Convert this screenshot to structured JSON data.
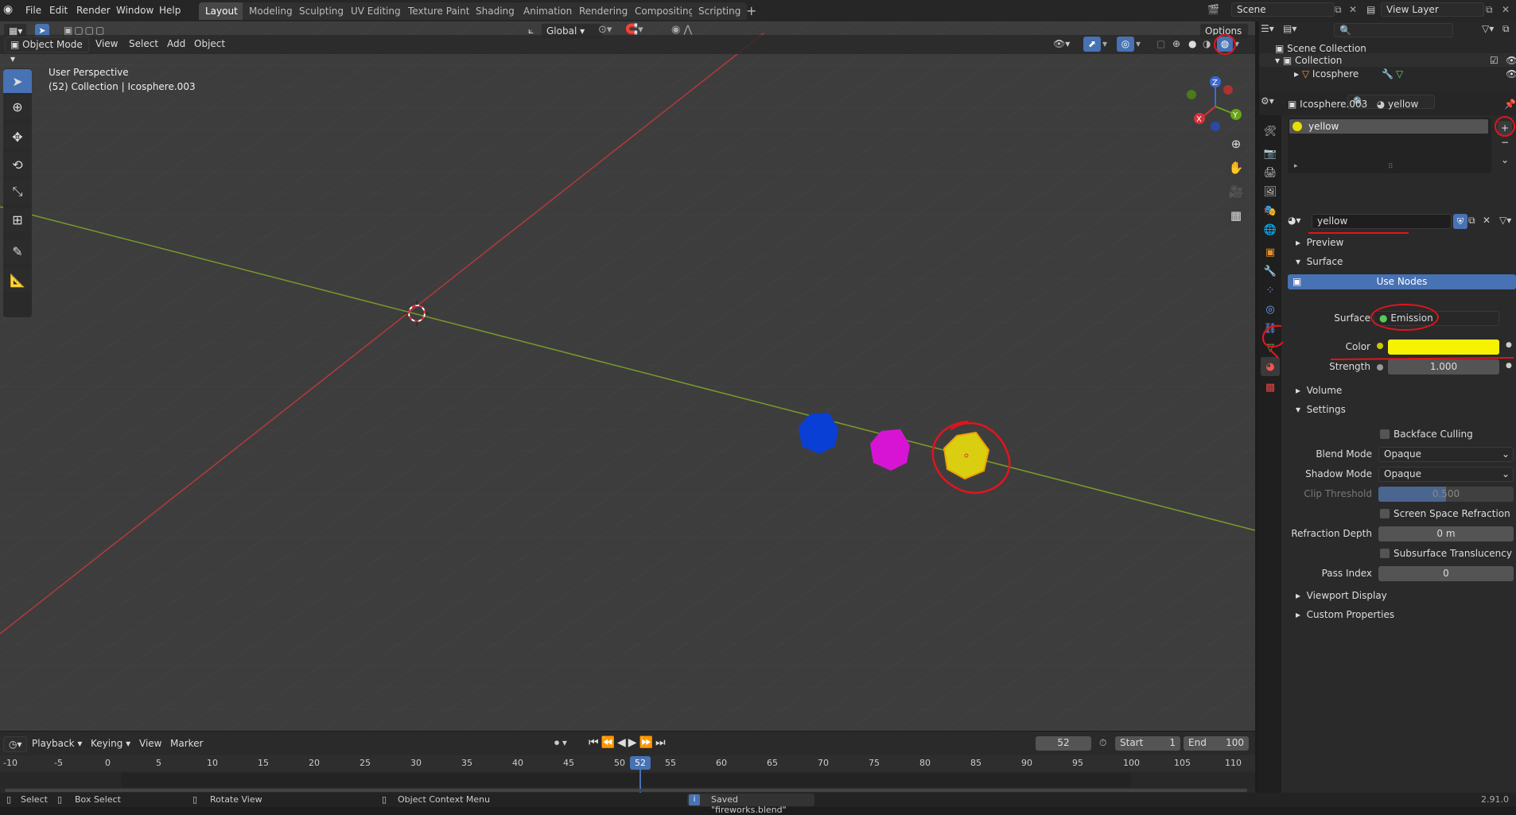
{
  "menu": {
    "file": "File",
    "edit": "Edit",
    "render": "Render",
    "window": "Window",
    "help": "Help"
  },
  "workspaces": [
    "Layout",
    "Modeling",
    "Sculpting",
    "UV Editing",
    "Texture Paint",
    "Shading",
    "Animation",
    "Rendering",
    "Compositing",
    "Scripting"
  ],
  "scene": {
    "name": "Scene",
    "view_layer": "View Layer"
  },
  "header": {
    "mode": "Object Mode",
    "view": "View",
    "select": "Select",
    "add": "Add",
    "object": "Object",
    "orientation": "Global",
    "options": "Options"
  },
  "viewport": {
    "perspective": "User Perspective",
    "collection_info": "(52) Collection | Icosphere.003"
  },
  "gizmo": {
    "x": "X",
    "y": "Y",
    "z": "Z"
  },
  "outliner": {
    "root": "Scene Collection",
    "collection": "Collection",
    "object": "Icosphere"
  },
  "properties": {
    "object_name": "Icosphere.003",
    "material_name": "yellow",
    "slot_name": "yellow",
    "datablock_name": "yellow",
    "preview": "Preview",
    "surface_section": "Surface",
    "use_nodes": "Use Nodes",
    "surface_label": "Surface",
    "surface_value": "Emission",
    "color_label": "Color",
    "color_value": "#f7f200",
    "strength_label": "Strength",
    "strength_value": "1.000",
    "volume_section": "Volume",
    "settings_section": "Settings",
    "backface": "Backface Culling",
    "blend_label": "Blend Mode",
    "blend_value": "Opaque",
    "shadow_label": "Shadow Mode",
    "shadow_value": "Opaque",
    "clip_label": "Clip Threshold",
    "clip_value": "0.500",
    "clip_fraction": 0.5,
    "ssr": "Screen Space Refraction",
    "refr_label": "Refraction Depth",
    "refr_value": "0 m",
    "sss": "Subsurface Translucency",
    "pass_label": "Pass Index",
    "pass_value": "0",
    "viewport_display": "Viewport Display",
    "custom_props": "Custom Properties"
  },
  "timeline": {
    "playback": "Playback",
    "keying": "Keying",
    "view": "View",
    "marker": "Marker",
    "current_frame": "52",
    "start_label": "Start",
    "start": "1",
    "end_label": "End",
    "end": "100",
    "ticks": [
      "-10",
      "-5",
      "0",
      "5",
      "10",
      "15",
      "20",
      "25",
      "30",
      "35",
      "40",
      "45",
      "50",
      "55",
      "60",
      "65",
      "70",
      "75",
      "80",
      "85",
      "90",
      "95",
      "100",
      "105",
      "110"
    ]
  },
  "status": {
    "select": "Select",
    "box_select": "Box Select",
    "rotate": "Rotate View",
    "context_menu": "Object Context Menu",
    "message": "Saved \"fireworks.blend\"",
    "version": "2.91.0"
  },
  "colors": {
    "blue": "#0a3fd6",
    "magenta": "#d814d4",
    "yellow": "#d9cf10",
    "accent": "#4772b3"
  }
}
